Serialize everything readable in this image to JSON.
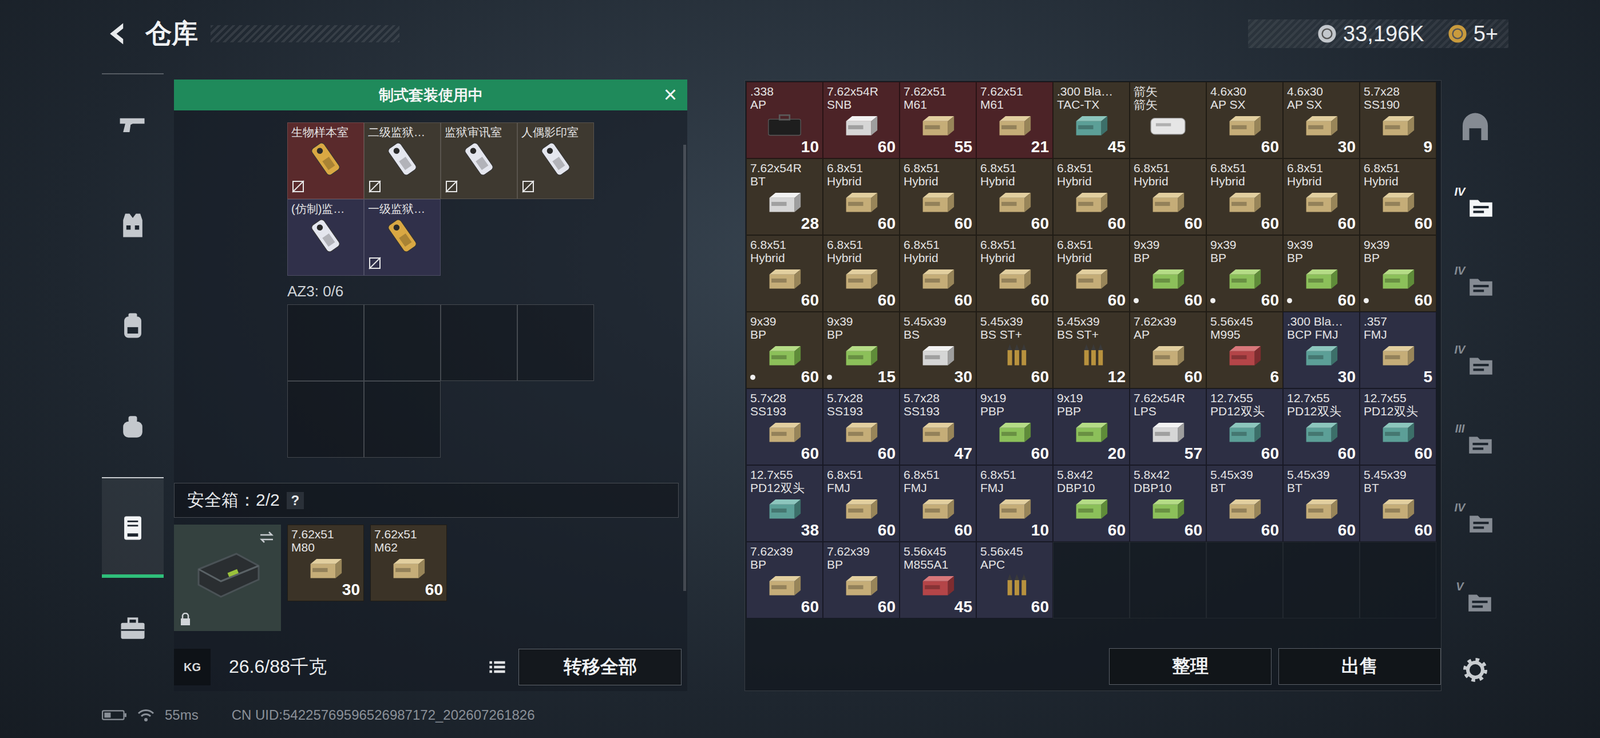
{
  "header": {
    "title": "仓库"
  },
  "currency": [
    {
      "amount": "33,196K",
      "kind": "silver"
    },
    {
      "amount": "5+",
      "kind": "gold"
    }
  ],
  "nav": [
    {
      "kind": "pistol",
      "selected": false
    },
    {
      "kind": "vest",
      "selected": false
    },
    {
      "kind": "backpack",
      "selected": false
    },
    {
      "kind": "pouch",
      "selected": false
    },
    {
      "kind": "safebox",
      "selected": true
    },
    {
      "kind": "toolbox",
      "selected": false
    }
  ],
  "loadout_banner": {
    "title": "制式套装使用中",
    "close": "×"
  },
  "keys": [
    {
      "name": "生物样本室",
      "color": "#5a2a2c",
      "kind": "gold",
      "bound": true
    },
    {
      "name": "二级监狱…",
      "color": "#3e3930",
      "kind": "white",
      "bound": true
    },
    {
      "name": "监狱审讯室",
      "color": "#3e3930",
      "kind": "white",
      "bound": true
    },
    {
      "name": "人偶影印室",
      "color": "#3e3930",
      "kind": "white",
      "bound": true
    },
    {
      "name": "(仿制)监…",
      "color": "#30304a",
      "kind": "white",
      "bound": false
    },
    {
      "name": "一级监狱…",
      "color": "#30304a",
      "kind": "gold",
      "bound": true
    }
  ],
  "container": {
    "label": "AZ3: 0/6",
    "slots": 6
  },
  "safe_box": {
    "label": "安全箱：2/2",
    "help": "?",
    "items": [
      {
        "name": "7.62x51",
        "sub": "M80",
        "count": "30",
        "color": "#3b3327",
        "kind": "tan",
        "marked": false
      },
      {
        "name": "7.62x51",
        "sub": "M62",
        "count": "60",
        "color": "#3b3327",
        "kind": "tan",
        "marked": false
      }
    ]
  },
  "weight": {
    "unit_icon": "KG",
    "value": "26.6/88千克"
  },
  "transfer_button": "转移全部",
  "stash": {
    "items": [
      {
        "name": ".338",
        "sub": "AP",
        "count": "10",
        "color": "#4c2327",
        "kind": "case",
        "marked": false
      },
      {
        "name": "7.62x54R",
        "sub": "SNB",
        "count": "60",
        "color": "#4c2327",
        "kind": "white",
        "marked": false
      },
      {
        "name": "7.62x51",
        "sub": "M61",
        "count": "55",
        "color": "#4c2327",
        "kind": "tan",
        "marked": false
      },
      {
        "name": "7.62x51",
        "sub": "M61",
        "count": "21",
        "color": "#4c2327",
        "kind": "tan",
        "marked": false
      },
      {
        "name": ".300 Bla…",
        "sub": "TAC-TX",
        "count": "45",
        "color": "#3b3327",
        "kind": "teal",
        "marked": false
      },
      {
        "name": "箭矢",
        "sub": "箭矢",
        "color": "#3b3327",
        "kind": "tin",
        "marked": false
      },
      {
        "name": "4.6x30",
        "sub": "AP SX",
        "count": "60",
        "color": "#3b3327",
        "kind": "tan",
        "marked": false
      },
      {
        "name": "4.6x30",
        "sub": "AP SX",
        "count": "30",
        "color": "#3b3327",
        "kind": "tan",
        "marked": false
      },
      {
        "name": "5.7x28",
        "sub": "SS190",
        "count": "9",
        "color": "#3b3327",
        "kind": "tan",
        "marked": false
      },
      {
        "name": "7.62x54R",
        "sub": "BT",
        "count": "28",
        "color": "#3b3327",
        "kind": "white",
        "marked": false
      },
      {
        "name": "6.8x51",
        "sub": "Hybrid",
        "count": "60",
        "color": "#3b3327",
        "kind": "tan",
        "marked": false
      },
      {
        "name": "6.8x51",
        "sub": "Hybrid",
        "count": "60",
        "color": "#3b3327",
        "kind": "tan",
        "marked": false
      },
      {
        "name": "6.8x51",
        "sub": "Hybrid",
        "count": "60",
        "color": "#3b3327",
        "kind": "tan",
        "marked": false
      },
      {
        "name": "6.8x51",
        "sub": "Hybrid",
        "count": "60",
        "color": "#3b3327",
        "kind": "tan",
        "marked": false
      },
      {
        "name": "6.8x51",
        "sub": "Hybrid",
        "count": "60",
        "color": "#3b3327",
        "kind": "tan",
        "marked": false
      },
      {
        "name": "6.8x51",
        "sub": "Hybrid",
        "count": "60",
        "color": "#3b3327",
        "kind": "tan",
        "marked": false
      },
      {
        "name": "6.8x51",
        "sub": "Hybrid",
        "count": "60",
        "color": "#3b3327",
        "kind": "tan",
        "marked": false
      },
      {
        "name": "6.8x51",
        "sub": "Hybrid",
        "count": "60",
        "color": "#3b3327",
        "kind": "tan",
        "marked": false
      },
      {
        "name": "6.8x51",
        "sub": "Hybrid",
        "count": "60",
        "color": "#3b3327",
        "kind": "tan",
        "marked": false
      },
      {
        "name": "6.8x51",
        "sub": "Hybrid",
        "count": "60",
        "color": "#3b3327",
        "kind": "tan",
        "marked": false
      },
      {
        "name": "6.8x51",
        "sub": "Hybrid",
        "count": "60",
        "color": "#3b3327",
        "kind": "tan",
        "marked": false
      },
      {
        "name": "6.8x51",
        "sub": "Hybrid",
        "count": "60",
        "color": "#3b3327",
        "kind": "tan",
        "marked": false
      },
      {
        "name": "6.8x51",
        "sub": "Hybrid",
        "count": "60",
        "color": "#3b3327",
        "kind": "tan",
        "marked": false
      },
      {
        "name": "9x39",
        "sub": "BP",
        "count": "60",
        "color": "#3b3327",
        "kind": "green",
        "marked": true
      },
      {
        "name": "9x39",
        "sub": "BP",
        "count": "60",
        "color": "#3b3327",
        "kind": "green",
        "marked": true
      },
      {
        "name": "9x39",
        "sub": "BP",
        "count": "60",
        "color": "#3b3327",
        "kind": "green",
        "marked": true
      },
      {
        "name": "9x39",
        "sub": "BP",
        "count": "60",
        "color": "#3b3327",
        "kind": "green",
        "marked": true
      },
      {
        "name": "9x39",
        "sub": "BP",
        "count": "60",
        "color": "#3b3327",
        "kind": "green",
        "marked": true
      },
      {
        "name": "9x39",
        "sub": "BP",
        "count": "15",
        "color": "#3b3327",
        "kind": "green",
        "marked": true
      },
      {
        "name": "5.45x39",
        "sub": "BS",
        "count": "30",
        "color": "#3b3327",
        "kind": "white",
        "marked": false
      },
      {
        "name": "5.45x39",
        "sub": "BS ST+",
        "count": "60",
        "color": "#3b3327",
        "kind": "round",
        "marked": false
      },
      {
        "name": "5.45x39",
        "sub": "BS ST+",
        "count": "12",
        "color": "#3b3327",
        "kind": "round",
        "marked": false
      },
      {
        "name": "7.62x39",
        "sub": "AP",
        "count": "60",
        "color": "#3b3327",
        "kind": "tan",
        "marked": false
      },
      {
        "name": "5.56x45",
        "sub": "M995",
        "count": "6",
        "color": "#3b3327",
        "kind": "red",
        "marked": false
      },
      {
        "name": ".300 Bla…",
        "sub": "BCP FMJ",
        "count": "30",
        "color": "#2d2f44",
        "kind": "teal",
        "marked": false
      },
      {
        "name": ".357",
        "sub": "FMJ",
        "count": "5",
        "color": "#2d2f44",
        "kind": "tan",
        "marked": false
      },
      {
        "name": "5.7x28",
        "sub": "SS193",
        "count": "60",
        "color": "#2d2f44",
        "kind": "tan",
        "marked": false
      },
      {
        "name": "5.7x28",
        "sub": "SS193",
        "count": "60",
        "color": "#2d2f44",
        "kind": "tan",
        "marked": false
      },
      {
        "name": "5.7x28",
        "sub": "SS193",
        "count": "47",
        "color": "#2d2f44",
        "kind": "tan",
        "marked": false
      },
      {
        "name": "9x19",
        "sub": "PBP",
        "count": "60",
        "color": "#2d2f44",
        "kind": "green",
        "marked": false
      },
      {
        "name": "9x19",
        "sub": "PBP",
        "count": "20",
        "color": "#2d2f44",
        "kind": "green",
        "marked": false
      },
      {
        "name": "7.62x54R",
        "sub": "LPS",
        "count": "57",
        "color": "#2d2f44",
        "kind": "white",
        "marked": false
      },
      {
        "name": "12.7x55",
        "sub": "PD12双头",
        "count": "60",
        "color": "#2d2f44",
        "kind": "teal",
        "marked": false
      },
      {
        "name": "12.7x55",
        "sub": "PD12双头",
        "count": "60",
        "color": "#2d2f44",
        "kind": "teal",
        "marked": false
      },
      {
        "name": "12.7x55",
        "sub": "PD12双头",
        "count": "60",
        "color": "#2d2f44",
        "kind": "teal",
        "marked": false
      },
      {
        "name": "12.7x55",
        "sub": "PD12双头",
        "count": "38",
        "color": "#2d2f44",
        "kind": "teal",
        "marked": false
      },
      {
        "name": "6.8x51",
        "sub": "FMJ",
        "count": "60",
        "color": "#2d2f44",
        "kind": "tan",
        "marked": false
      },
      {
        "name": "6.8x51",
        "sub": "FMJ",
        "count": "60",
        "color": "#2d2f44",
        "kind": "tan",
        "marked": false
      },
      {
        "name": "6.8x51",
        "sub": "FMJ",
        "count": "10",
        "color": "#2d2f44",
        "kind": "tan",
        "marked": false
      },
      {
        "name": "5.8x42",
        "sub": "DBP10",
        "count": "60",
        "color": "#2d2f44",
        "kind": "green",
        "marked": false
      },
      {
        "name": "5.8x42",
        "sub": "DBP10",
        "count": "60",
        "color": "#2d2f44",
        "kind": "green",
        "marked": false
      },
      {
        "name": "5.45x39",
        "sub": "BT",
        "count": "60",
        "color": "#2d2f44",
        "kind": "tan",
        "marked": false
      },
      {
        "name": "5.45x39",
        "sub": "BT",
        "count": "60",
        "color": "#2d2f44",
        "kind": "tan",
        "marked": false
      },
      {
        "name": "5.45x39",
        "sub": "BT",
        "count": "60",
        "color": "#2d2f44",
        "kind": "tan",
        "marked": false
      },
      {
        "name": "7.62x39",
        "sub": "BP",
        "count": "60",
        "color": "#2d2f44",
        "kind": "tan",
        "marked": false
      },
      {
        "name": "7.62x39",
        "sub": "BP",
        "count": "60",
        "color": "#2d2f44",
        "kind": "tan",
        "marked": false
      },
      {
        "name": "5.56x45",
        "sub": "M855A1",
        "count": "45",
        "color": "#2d2f44",
        "kind": "red",
        "marked": false
      },
      {
        "name": "5.56x45",
        "sub": "APC",
        "count": "60",
        "color": "#2d2f44",
        "kind": "round",
        "marked": false
      }
    ]
  },
  "actions": [
    "整理",
    "出售"
  ],
  "tabs": [
    {
      "kind": "home",
      "selected": false
    },
    {
      "kind": "tier",
      "tier": "IV",
      "selected": true
    },
    {
      "kind": "tier",
      "tier": "IV",
      "selected": false
    },
    {
      "kind": "tier",
      "tier": "IV",
      "selected": false
    },
    {
      "kind": "tier",
      "tier": "III",
      "selected": false
    },
    {
      "kind": "tier",
      "tier": "IV",
      "selected": false
    },
    {
      "kind": "tier",
      "tier": "V",
      "selected": false
    }
  ],
  "status": {
    "ping": "55ms",
    "uid": "CN UID:54225769596526987172_202607261826"
  }
}
